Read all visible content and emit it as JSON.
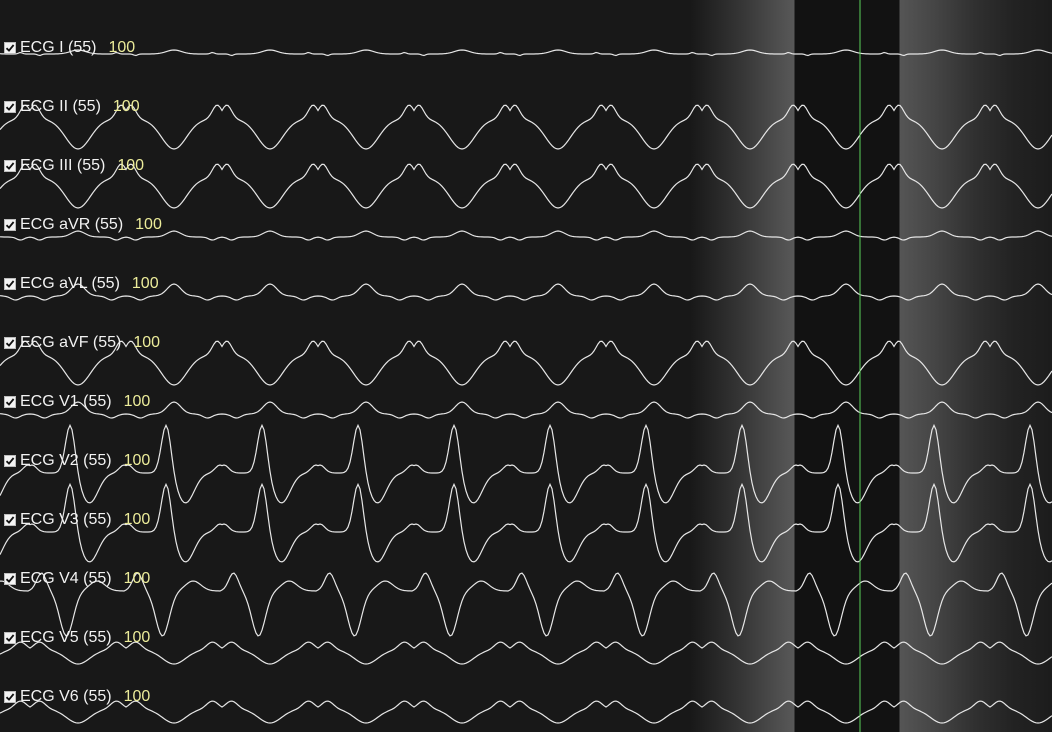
{
  "colors": {
    "trace": "#e6e6e6",
    "label": "#f2f2f2",
    "scale": "#ecec9a",
    "cursor": "#5ad25a"
  },
  "icons": {
    "check": "checkbox-checked-icon"
  },
  "channels": [
    {
      "label": "ECG I (55)",
      "scale": "100",
      "checked": true,
      "shape": "lead_i"
    },
    {
      "label": "ECG II (55)",
      "scale": "100",
      "checked": true,
      "shape": "wave_inv"
    },
    {
      "label": "ECG III (55)",
      "scale": "100",
      "checked": true,
      "shape": "wave_inv"
    },
    {
      "label": "ECG aVR (55)",
      "scale": "100",
      "checked": true,
      "shape": "bump_small"
    },
    {
      "label": "ECG aVL (55)",
      "scale": "100",
      "checked": true,
      "shape": "bump"
    },
    {
      "label": "ECG aVF (55)",
      "scale": "100",
      "checked": true,
      "shape": "wave_inv"
    },
    {
      "label": "ECG V1 (55)",
      "scale": "100",
      "checked": true,
      "shape": "bump"
    },
    {
      "label": "ECG V2 (55)",
      "scale": "100",
      "checked": true,
      "shape": "spike"
    },
    {
      "label": "ECG V3 (55)",
      "scale": "100",
      "checked": true,
      "shape": "spike"
    },
    {
      "label": "ECG V4 (55)",
      "scale": "100",
      "checked": true,
      "shape": "deep"
    },
    {
      "label": "ECG V5 (55)",
      "scale": "100",
      "checked": true,
      "shape": "wave_small"
    },
    {
      "label": "ECG V6 (55)",
      "scale": "100",
      "checked": true,
      "shape": "wave_small"
    }
  ]
}
